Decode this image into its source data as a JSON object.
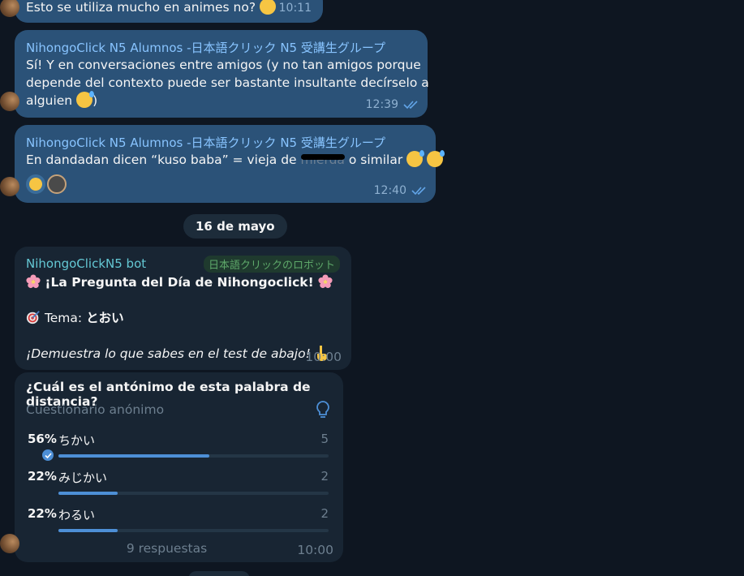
{
  "messages": {
    "m1": {
      "text": "Esto se utiliza mucho en animes no?",
      "time": "10:11",
      "emoji": "thinking-face"
    },
    "m2": {
      "sender": "NihongoClick N5 Alumnos -日本語クリック N5 受講生グループ",
      "line1": "Sí! Y en conversaciones entre amigos (y no tan amigos porque",
      "line2": "depende del contexto puede ser bastante insultante decírselo a",
      "line3": "alguien",
      "time": "12:39"
    },
    "m3": {
      "sender": "NihongoClick N5 Alumnos -日本語クリック N5 受講生グループ",
      "text_before": "En dandadan dicen “kuso baba” = vieja de",
      "redacted": "mierda",
      "text_after": "o similar",
      "time": "12:40"
    }
  },
  "date_separator": "16 de mayo",
  "bot_message": {
    "sender": "NihongoClickN5 bot",
    "badge": "日本語クリックのロボット",
    "title": "¡La Pregunta del Día de Nihongoclick!",
    "topic_label": "Tema:",
    "topic_value": "とおい",
    "cta": "¡Demuestra lo que sabes en el test de abajo!",
    "time": "10:00"
  },
  "poll": {
    "question": "¿Cuál es el antónimo de esta palabra de distancia?",
    "type": "Cuestionario anónimo",
    "options": [
      {
        "percent": "56%",
        "label": "ちかい",
        "count": "5",
        "fraction": 0.56,
        "chosen": true
      },
      {
        "percent": "22%",
        "label": "みじかい",
        "count": "2",
        "fraction": 0.22,
        "chosen": false
      },
      {
        "percent": "22%",
        "label": "わるい",
        "count": "2",
        "fraction": 0.22,
        "chosen": false
      }
    ],
    "answers": "9 respuestas",
    "time": "10:00"
  },
  "colors": {
    "background": "#0e1621",
    "outgoing_bubble": "#2b5278",
    "incoming_bubble": "#182533",
    "accent": "#4d8fd6"
  }
}
